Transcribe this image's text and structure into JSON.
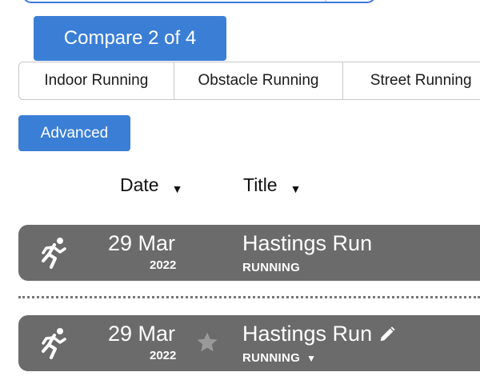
{
  "compare_button": {
    "label": "Compare 2 of 4"
  },
  "tabs": [
    {
      "label": "Indoor Running"
    },
    {
      "label": "Obstacle Running"
    },
    {
      "label": "Street Running"
    }
  ],
  "advanced_button": {
    "label": "Advanced"
  },
  "columns": {
    "date": {
      "label": "Date",
      "sort_icon": "▼"
    },
    "title": {
      "label": "Title",
      "sort_icon": "▼"
    }
  },
  "activities": [
    {
      "icon": "running-figure-icon",
      "date_day": "29 Mar",
      "date_year": "2022",
      "title": "Hastings Run",
      "sport": "RUNNING"
    },
    {
      "icon": "running-figure-icon",
      "date_day": "29 Mar",
      "date_year": "2022",
      "title": "Hastings Run",
      "sport": "RUNNING",
      "sport_dropdown_icon": "▼",
      "favorite_icon": "star-icon",
      "edit_icon": "pencil-icon"
    }
  ],
  "colors": {
    "accent_blue": "#3b7ed6",
    "row_gray": "#6b6b6b"
  }
}
